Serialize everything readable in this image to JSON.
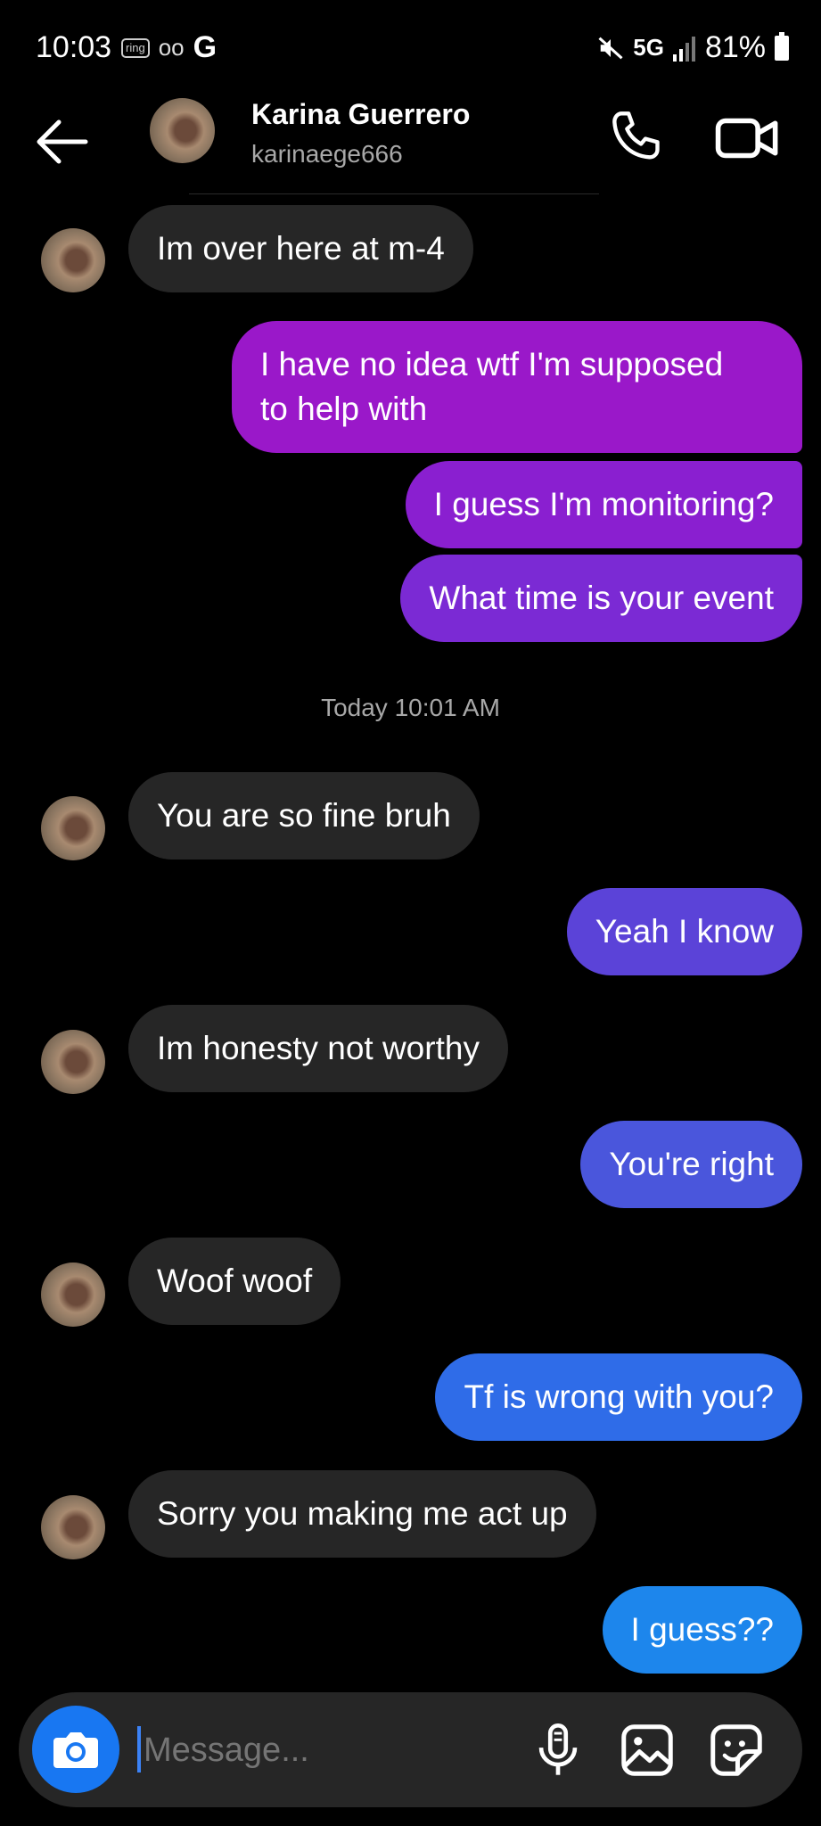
{
  "status_bar": {
    "time": "10:03",
    "ring_badge": "ring",
    "voicemail_glyph": "oo",
    "google_glyph": "G",
    "network": "5G",
    "battery": "81%"
  },
  "header": {
    "name": "Karina Guerrero",
    "username": "karinaege666"
  },
  "messages": [
    {
      "id": "m1",
      "side": "in",
      "text": "Im over here at m-4"
    },
    {
      "id": "m2",
      "side": "out",
      "line1": "I have no idea wtf I'm supposed",
      "line2": "to help with",
      "color": "#9a18c9"
    },
    {
      "id": "m3",
      "side": "out",
      "text": "I guess I'm monitoring?",
      "color": "#8a1fd0"
    },
    {
      "id": "m4",
      "side": "out",
      "text": "What time is your event",
      "color": "#7b2ad4"
    },
    {
      "id": "ts",
      "timestamp": "Today 10:01 AM"
    },
    {
      "id": "m5",
      "side": "in",
      "text": "You are so fine bruh"
    },
    {
      "id": "m6",
      "side": "out",
      "text": "Yeah I know",
      "color": "#5b43d8"
    },
    {
      "id": "m7",
      "side": "in",
      "text": "Im honesty not worthy"
    },
    {
      "id": "m8",
      "side": "out",
      "text": "You're right",
      "color": "#4a56dc"
    },
    {
      "id": "m9",
      "side": "in",
      "text": "Woof woof"
    },
    {
      "id": "m10",
      "side": "out",
      "text": "Tf is wrong with you?",
      "color": "#2f6ce8"
    },
    {
      "id": "m11",
      "side": "in",
      "text": "Sorry you making me act up"
    },
    {
      "id": "m12",
      "side": "out",
      "text": "I guess??",
      "color": "#1d86ec"
    }
  ],
  "composer": {
    "placeholder": "Message..."
  },
  "icons": {
    "back": "arrow-left-icon",
    "call": "phone-icon",
    "video": "video-camera-icon",
    "camera": "camera-icon",
    "mic": "microphone-icon",
    "gallery": "image-icon",
    "sticker": "sticker-icon"
  },
  "colors": {
    "incoming_bubble": "#262626",
    "accent": "#1877f2"
  }
}
